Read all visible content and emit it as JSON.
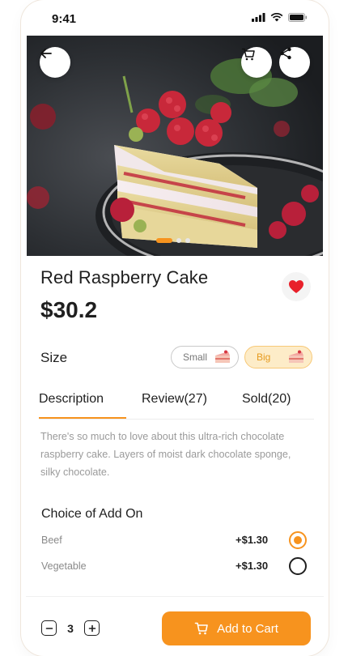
{
  "status_bar": {
    "time": "9:41"
  },
  "hero": {
    "carousel_total": 3,
    "carousel_active": 1
  },
  "product": {
    "name": "Red Raspberry Cake",
    "price": "$30.2",
    "favorited": true
  },
  "size": {
    "label": "Size",
    "options": [
      {
        "label": "Small",
        "selected": false
      },
      {
        "label": "Big",
        "selected": true
      }
    ]
  },
  "tabs": [
    {
      "label": "Description",
      "active": true
    },
    {
      "label": "Review(27)",
      "active": false
    },
    {
      "label": "Sold(20)",
      "active": false
    }
  ],
  "description": "There's so much to love about this ultra-rich chocolate raspberry cake. Layers of moist dark chocolate sponge, silky chocolate.",
  "addons": {
    "title": "Choice of Add On",
    "items": [
      {
        "name": "Beef",
        "price": "+$1.30",
        "selected": true
      },
      {
        "name": "Vegetable",
        "price": "+$1.30",
        "selected": false
      }
    ]
  },
  "cart": {
    "quantity": "3",
    "button_label": "Add to Cart"
  },
  "colors": {
    "accent": "#f7931e",
    "heart": "#e8202a",
    "big_bg": "#fdecc8"
  },
  "icons": [
    "back-arrow-icon",
    "cart-icon",
    "share-icon",
    "heart-icon",
    "cake-slice-icon",
    "minus-icon",
    "plus-icon",
    "signal-icon",
    "wifi-icon",
    "battery-icon"
  ]
}
